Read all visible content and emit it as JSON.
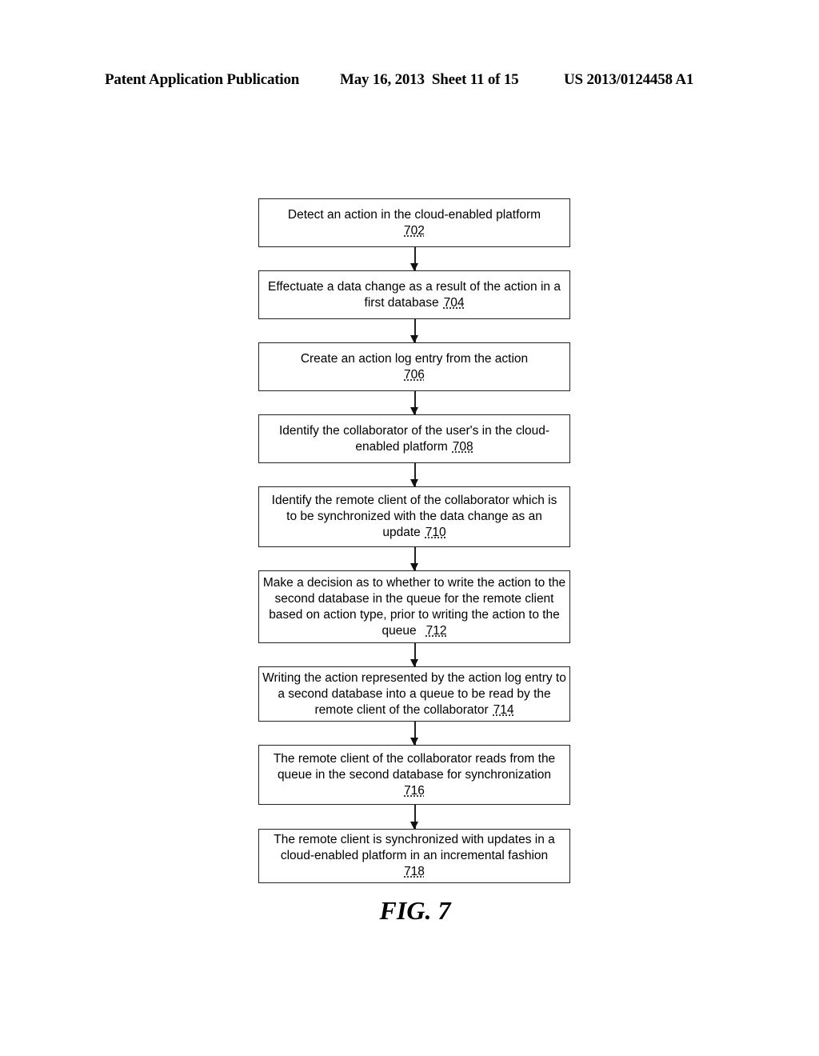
{
  "header": {
    "publication": "Patent Application Publication",
    "date_sheet": "May 16, 2013  Sheet 11 of 15",
    "number": "US 2013/0124458 A1"
  },
  "flowchart": {
    "steps": [
      {
        "text": "Detect an action in the cloud-enabled platform",
        "ref": "702",
        "ref_on_new_line": true
      },
      {
        "text": "Effectuate a data change as a result of the action in a first database",
        "ref": "704",
        "ref_on_new_line": false
      },
      {
        "text": "Create an action log entry from the action",
        "ref": "706",
        "ref_on_new_line": true
      },
      {
        "text": "Identify the collaborator of the user's in the cloud-enabled platform",
        "ref": "708",
        "ref_on_new_line": false
      },
      {
        "text": "Identify the remote client of the collaborator which is to be synchronized with the data change as an update",
        "ref": "710",
        "ref_on_new_line": false
      },
      {
        "text": "Make a decision as to whether to write the action to the second database in the queue for the remote client based on action type, prior to writing the action to the queue",
        "ref": "712",
        "ref_on_new_line": false
      },
      {
        "text": "Writing the action represented by the action log entry to a second database into a queue to be read by the remote client of the collaborator",
        "ref": "714",
        "ref_on_new_line": false
      },
      {
        "text": "The remote client of the collaborator reads from the queue in the second database for synchronization",
        "ref": "716",
        "ref_on_new_line": true
      },
      {
        "text": "The remote client is synchronized with updates in a cloud-enabled platform in an incremental fashion",
        "ref": "718",
        "ref_on_new_line": true
      }
    ]
  },
  "figure_label": "FIG. 7"
}
